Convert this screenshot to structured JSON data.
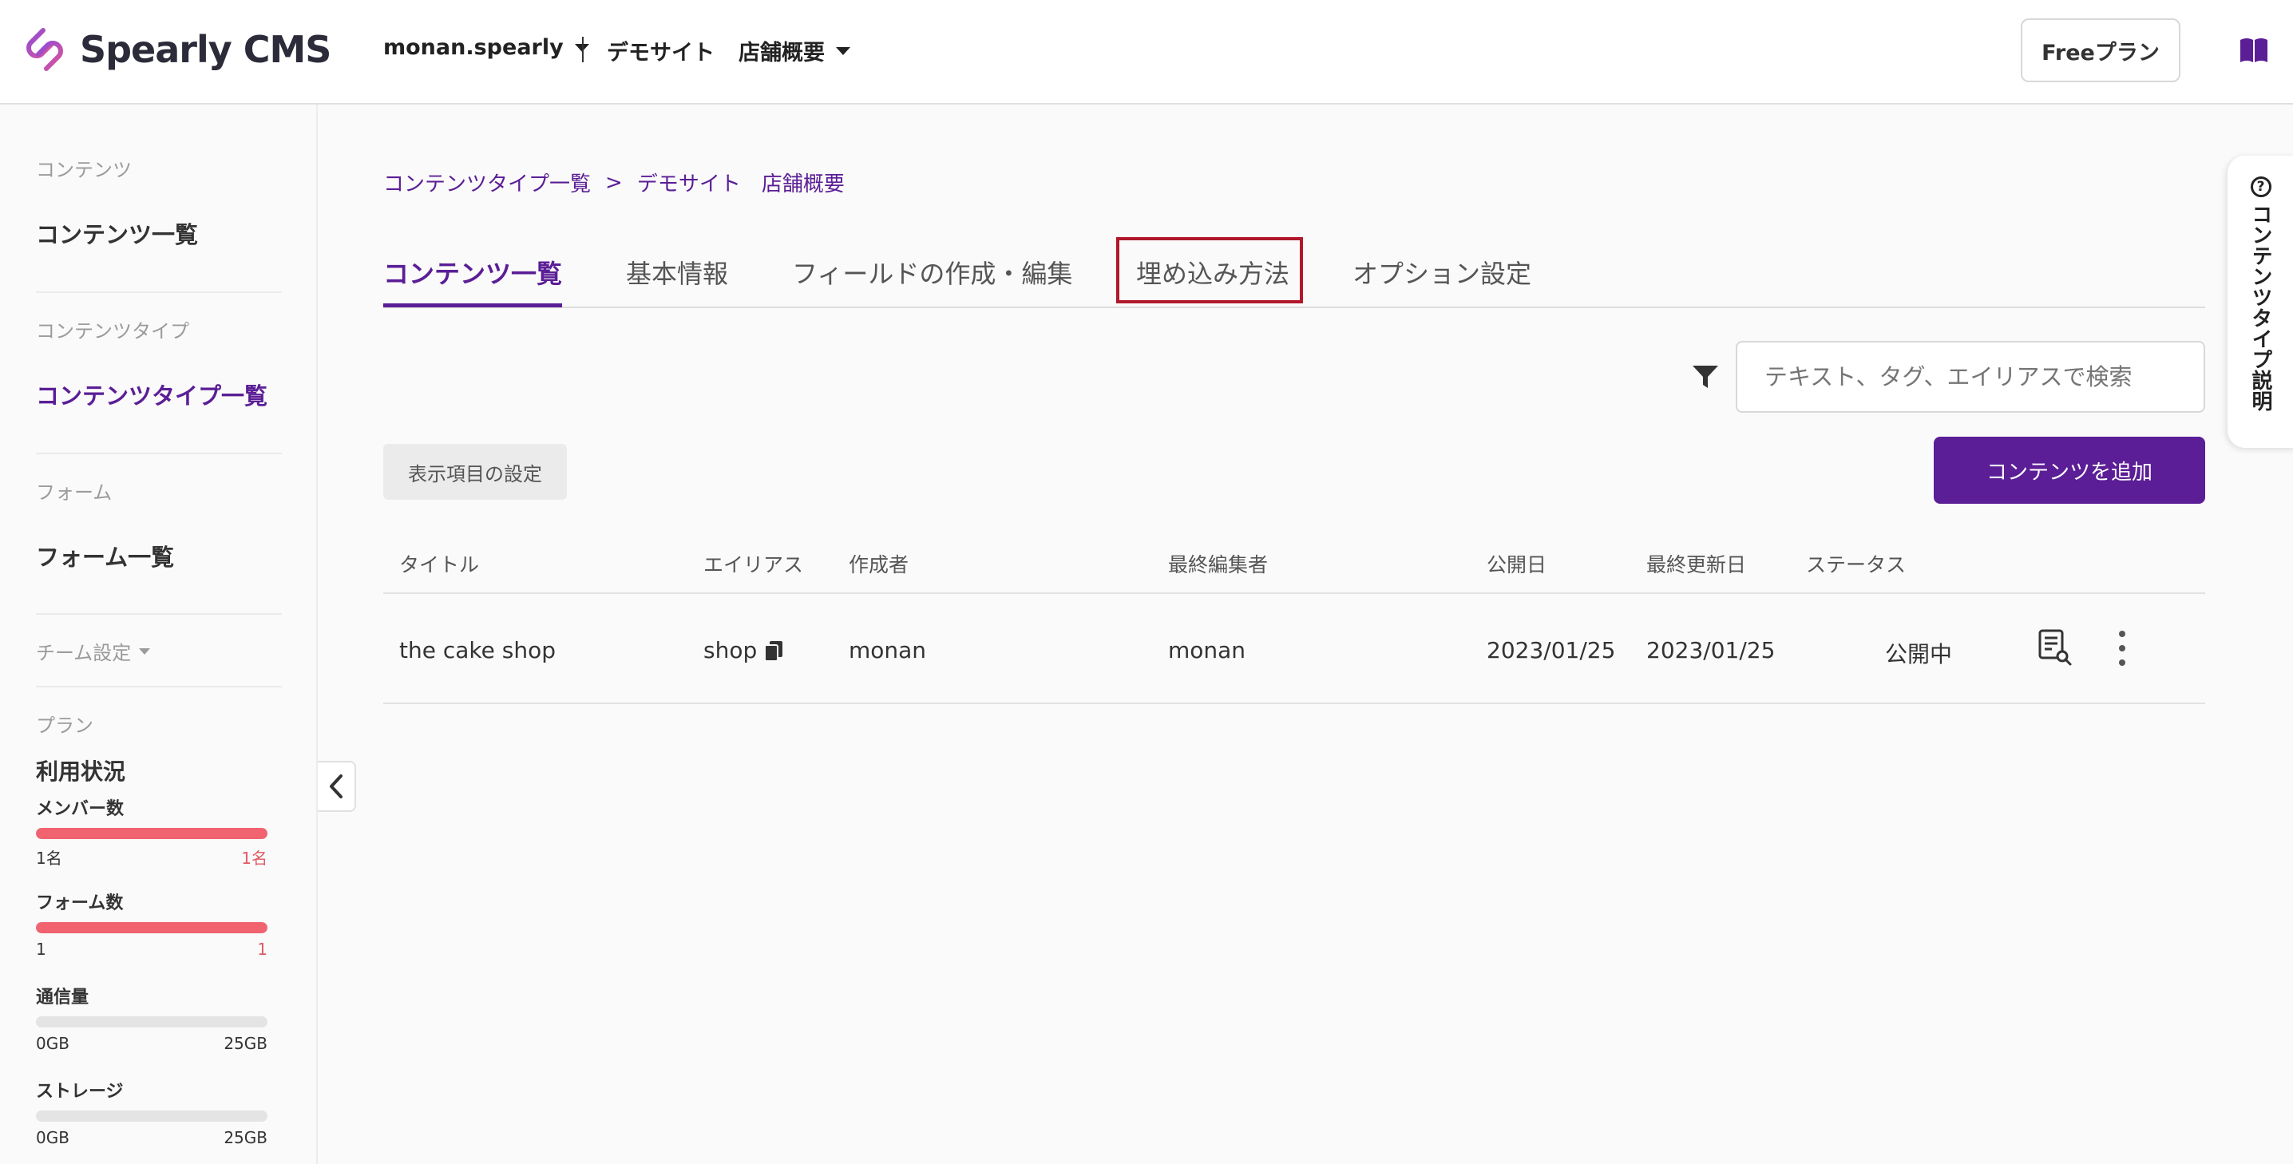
{
  "header": {
    "logo_text": "Spearly CMS",
    "team_name": "monan.spearly",
    "site_name": "デモサイト",
    "content_type_name": "店舗概要",
    "plan_button": "Freeプラン"
  },
  "sidebar": {
    "section_content": "コンテンツ",
    "item_content_list": "コンテンツ一覧",
    "section_content_type": "コンテンツタイプ",
    "item_content_type_list": "コンテンツタイプ一覧",
    "section_form": "フォーム",
    "item_form_list": "フォーム一覧",
    "team_settings": "チーム設定",
    "section_plan": "プラン",
    "usage_title": "利用状況",
    "usage": [
      {
        "label": "メンバー数",
        "min": "1名",
        "max": "1名",
        "fill": 1.0
      },
      {
        "label": "フォーム数",
        "min": "1",
        "max": "1",
        "fill": 1.0
      },
      {
        "label": "通信量",
        "min": "0GB",
        "max": "25GB",
        "fill": 0.0
      },
      {
        "label": "ストレージ",
        "min": "0GB",
        "max": "25GB",
        "fill": 0.0
      }
    ]
  },
  "breadcrumb": {
    "parent": "コンテンツタイプ一覧",
    "separator": ">",
    "current": "デモサイト　店舗概要"
  },
  "tabs": [
    {
      "label": "コンテンツ一覧",
      "active": true
    },
    {
      "label": "基本情報",
      "active": false
    },
    {
      "label": "フィールドの作成・編集",
      "active": false
    },
    {
      "label": "埋め込み方法",
      "active": false
    },
    {
      "label": "オプション設定",
      "active": false
    }
  ],
  "search": {
    "placeholder": "テキスト、タグ、エイリアスで検索"
  },
  "display_settings_button": "表示項目の設定",
  "add_content_button": "コンテンツを追加",
  "table": {
    "headers": [
      "タイトル",
      "エイリアス",
      "作成者",
      "最終編集者",
      "公開日",
      "最終更新日",
      "ステータス"
    ],
    "rows": [
      {
        "title": "the cake shop",
        "alias": "shop",
        "author": "monan",
        "editor": "monan",
        "published": "2023/01/25",
        "updated": "2023/01/25",
        "status": "公開中"
      }
    ]
  },
  "side_tab": {
    "icon_text": "?",
    "label": "コンテンツタイプ説明"
  },
  "colors": {
    "accent": "#5b1e96",
    "usage_bar": "#f0636f",
    "highlight": "#b0182b"
  }
}
